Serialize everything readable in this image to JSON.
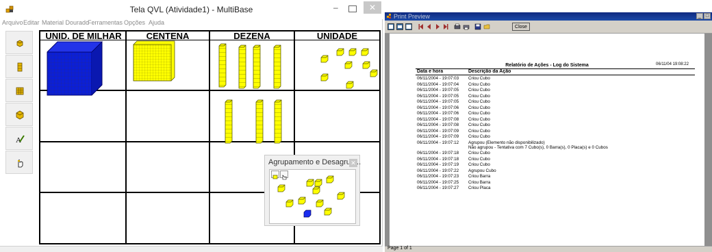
{
  "left_window": {
    "title": "Tela QVL (Atividade1) - MultiBase",
    "controls": {
      "minimize": "–",
      "close": "✕"
    },
    "menu": [
      "Arquivo",
      "Editar",
      "Material Dourado",
      "Ferramentas",
      "Opções",
      "Ajuda"
    ],
    "tools": [
      {
        "icon": "unit-cube-icon"
      },
      {
        "icon": "bar-block-icon"
      },
      {
        "icon": "plate-block-icon"
      },
      {
        "icon": "big-cube-icon"
      },
      {
        "icon": "pencil-icon"
      },
      {
        "icon": "hand-pointer-icon"
      }
    ],
    "board": {
      "columns": [
        "UNID. DE MILHAR",
        "CENTENA",
        "DEZENA",
        "UNIDADE"
      ],
      "colors": {
        "thousand_cube": "#0b1fd6",
        "blocks": "#ffff00",
        "grid": "#000000"
      }
    },
    "popup": {
      "title": "Agrupamento e Desagrup...",
      "close": "✕"
    }
  },
  "right_window": {
    "title": "Print Preview",
    "controls": {
      "minimize": "_",
      "maximize": "□"
    },
    "toolbar": {
      "close_label": "Close"
    },
    "report": {
      "title": "Relatório de Ações - Log do Sistema",
      "stamp": "06/11/04 19:08:22",
      "headers": {
        "date": "Data e hora",
        "action": "Descrição da Ação"
      },
      "rows": [
        {
          "date": "06/11/2004 - 19:07:03",
          "action": "Criou Cubo"
        },
        {
          "date": "06/11/2004 - 19:07:04",
          "action": "Criou Cubo"
        },
        {
          "date": "06/11/2004 - 19:07:05",
          "action": "Criou Cubo"
        },
        {
          "date": "06/11/2004 - 19:07:05",
          "action": "Criou Cubo"
        },
        {
          "date": "06/11/2004 - 19:07:05",
          "action": "Criou Cubo"
        },
        {
          "date": "06/11/2004 - 19:07:06",
          "action": "Criou Cubo"
        },
        {
          "date": "06/11/2004 - 19:07:06",
          "action": "Criou Cubo"
        },
        {
          "date": "06/11/2004 - 19:07:08",
          "action": "Criou Cubo"
        },
        {
          "date": "06/11/2004 - 19:07:08",
          "action": "Criou Cubo"
        },
        {
          "date": "06/11/2004 - 19:07:09",
          "action": "Criou Cubo"
        },
        {
          "date": "06/11/2004 - 19:07:09",
          "action": "Criou Cubo"
        },
        {
          "date": "06/11/2004 - 19:07:12",
          "action": "Agrupou (Elemento não disponibilizado)"
        },
        {
          "date": "",
          "action": "Não agrupou - Tentativa com 7 Cubo(s), 0 Barra(s), 0 Placa(s) e 0 Cubos"
        },
        {
          "date": "06/11/2004 - 19:07:18",
          "action": "Criou Cubo"
        },
        {
          "date": "06/11/2004 - 19:07:18",
          "action": "Criou Cubo"
        },
        {
          "date": "06/11/2004 - 19:07:19",
          "action": "Criou Cubo"
        },
        {
          "date": "06/11/2004 - 19:07:22",
          "action": "Agrupou Cubo"
        },
        {
          "date": "06/11/2004 - 19:07:23",
          "action": "Criou Barra"
        },
        {
          "date": "06/11/2004 - 19:07:25",
          "action": "Criou Barra"
        },
        {
          "date": "06/11/2004 - 19:07:27",
          "action": "Criou Placa"
        }
      ]
    },
    "status": "Page 1 of 1"
  }
}
